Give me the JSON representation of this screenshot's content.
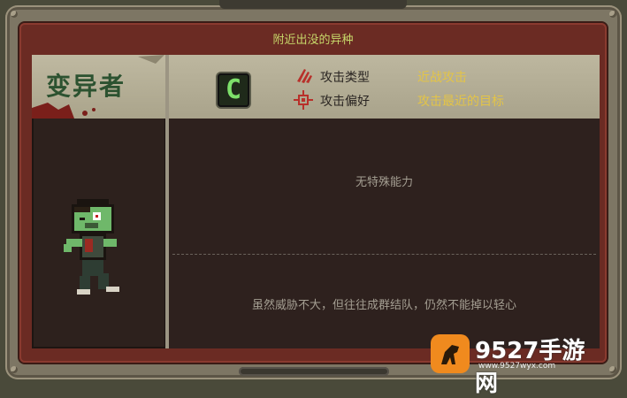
{
  "panel": {
    "title": "附近出没的异种"
  },
  "monster": {
    "name": "变异者",
    "grade": "C",
    "attack_type_label": "攻击类型",
    "attack_type_value": "近战攻击",
    "attack_pref_label": "攻击偏好",
    "attack_pref_value": "攻击最近的目标",
    "ability": "无特殊能力",
    "description": "虽然威胁不大，但往往成群结队，仍然不能掉以轻心"
  },
  "watermark": {
    "main": "9527手游网",
    "sub": "www.9527wyx.com"
  },
  "colors": {
    "title": "#c7d86a",
    "value": "#e3c447",
    "grade": "#7de06a",
    "panel": "#6b2b23"
  },
  "icons": {
    "attack_type": "claw-icon",
    "attack_pref": "crosshair-icon"
  }
}
